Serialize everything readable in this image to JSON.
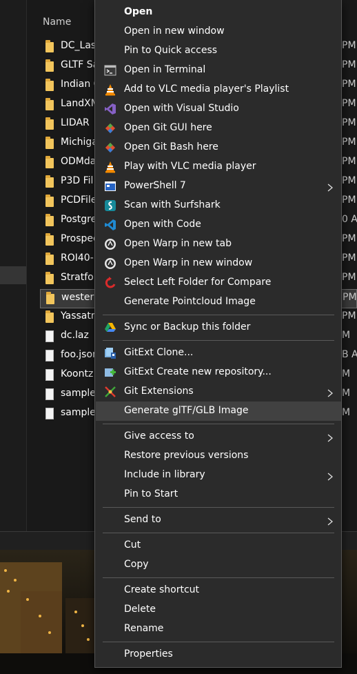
{
  "explorer": {
    "column_name": "Name",
    "files": [
      {
        "name": "DC_Las",
        "date": "PM",
        "type": "folder"
      },
      {
        "name": "GLTF Sa",
        "date": "PM",
        "type": "folder"
      },
      {
        "name": "Indian C",
        "date": "PM",
        "type": "folder"
      },
      {
        "name": "LandXM",
        "date": "PM",
        "type": "folder"
      },
      {
        "name": "LIDAR",
        "date": "PM",
        "type": "folder"
      },
      {
        "name": "Michiga",
        "date": "PM",
        "type": "folder"
      },
      {
        "name": "ODMda",
        "date": "PM",
        "type": "folder"
      },
      {
        "name": "P3D Fil",
        "date": "PM",
        "type": "folder"
      },
      {
        "name": "PCDFile",
        "date": "PM",
        "type": "folder"
      },
      {
        "name": "Postgre",
        "date": "0 A",
        "type": "folder"
      },
      {
        "name": "Prospec",
        "date": "PM",
        "type": "folder"
      },
      {
        "name": "ROI40-",
        "date": "PM",
        "type": "folder"
      },
      {
        "name": "Stratfor",
        "date": "PM",
        "type": "folder"
      },
      {
        "name": "western",
        "date": "PM",
        "type": "folder",
        "selected": true
      },
      {
        "name": "Yassatri",
        "date": "PM",
        "type": "folder"
      },
      {
        "name": "dc.laz",
        "date": "M",
        "type": "file"
      },
      {
        "name": "foo.json",
        "date": "B A",
        "type": "file"
      },
      {
        "name": "Koontz",
        "date": "M",
        "type": "file"
      },
      {
        "name": "sample",
        "date": "M",
        "type": "file"
      },
      {
        "name": "sample",
        "date": "M",
        "type": "file"
      }
    ]
  },
  "menu": {
    "groups": [
      [
        {
          "label": "Open",
          "bold": true,
          "icon": "none"
        },
        {
          "label": "Open in new window",
          "icon": "none"
        },
        {
          "label": "Pin to Quick access",
          "icon": "none"
        },
        {
          "label": "Open in Terminal",
          "icon": "terminal-icon"
        },
        {
          "label": "Add to VLC media player's Playlist",
          "icon": "vlc-icon"
        },
        {
          "label": "Open with Visual Studio",
          "icon": "visual-studio-icon"
        },
        {
          "label": "Open Git GUI here",
          "icon": "git-icon"
        },
        {
          "label": "Open Git Bash here",
          "icon": "git-icon"
        },
        {
          "label": "Play with VLC media player",
          "icon": "vlc-icon"
        },
        {
          "label": "PowerShell 7",
          "icon": "powershell-icon",
          "submenu": true
        },
        {
          "label": "Scan with Surfshark",
          "icon": "surfshark-icon"
        },
        {
          "label": "Open with Code",
          "icon": "vscode-icon"
        },
        {
          "label": "Open Warp in new tab",
          "icon": "warp-icon"
        },
        {
          "label": "Open Warp in new window",
          "icon": "warp-icon"
        },
        {
          "label": "Select Left Folder for Compare",
          "icon": "compare-icon"
        },
        {
          "label": "Generate Pointcloud Image",
          "icon": "none"
        }
      ],
      [
        {
          "label": "Sync or Backup this folder",
          "icon": "google-drive-icon"
        }
      ],
      [
        {
          "label": "GitExt Clone...",
          "icon": "gitext-clone-icon"
        },
        {
          "label": "GitExt Create new repository...",
          "icon": "gitext-new-icon"
        },
        {
          "label": "Git Extensions",
          "icon": "gitext-icon",
          "submenu": true
        },
        {
          "label": "Generate glTF/GLB Image",
          "icon": "none",
          "hover": true
        }
      ],
      [
        {
          "label": "Give access to",
          "icon": "none",
          "submenu": true
        },
        {
          "label": "Restore previous versions",
          "icon": "none"
        },
        {
          "label": "Include in library",
          "icon": "none",
          "submenu": true
        },
        {
          "label": "Pin to Start",
          "icon": "none"
        }
      ],
      [
        {
          "label": "Send to",
          "icon": "none",
          "submenu": true
        }
      ],
      [
        {
          "label": "Cut",
          "icon": "none"
        },
        {
          "label": "Copy",
          "icon": "none"
        }
      ],
      [
        {
          "label": "Create shortcut",
          "icon": "none"
        },
        {
          "label": "Delete",
          "icon": "none"
        },
        {
          "label": "Rename",
          "icon": "none"
        }
      ],
      [
        {
          "label": "Properties",
          "icon": "none"
        }
      ]
    ]
  },
  "colors": {
    "menu_bg": "#2b2b2b",
    "hover_bg": "#414141",
    "folder": "#f2c55c",
    "explorer_bg": "#191919"
  }
}
